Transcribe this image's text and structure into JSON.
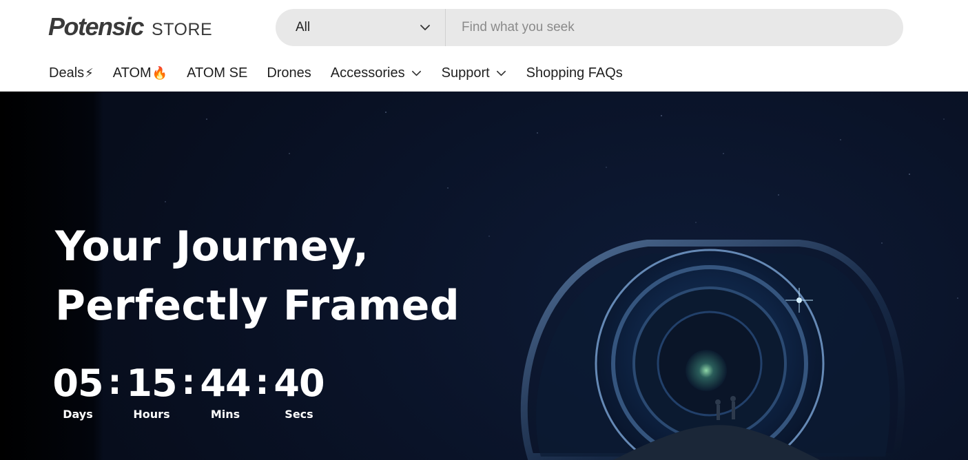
{
  "brand": {
    "name": "Potensic",
    "suffix": "STORE"
  },
  "search": {
    "category": "All",
    "placeholder": "Find what you seek"
  },
  "nav": [
    {
      "label": "Deals",
      "emoji": "⚡",
      "dropdown": false
    },
    {
      "label": "ATOM",
      "emoji": "🔥",
      "dropdown": false
    },
    {
      "label": "ATOM SE",
      "emoji": "",
      "dropdown": false
    },
    {
      "label": "Drones",
      "emoji": "",
      "dropdown": false
    },
    {
      "label": "Accessories",
      "emoji": "",
      "dropdown": true
    },
    {
      "label": "Support",
      "emoji": "",
      "dropdown": true
    },
    {
      "label": "Shopping FAQs",
      "emoji": "",
      "dropdown": false
    }
  ],
  "hero": {
    "headline_line1": "Your Journey,",
    "headline_line2": "Perfectly Framed",
    "countdown": {
      "days": "05",
      "hours": "15",
      "mins": "44",
      "secs": "40",
      "days_label": "Days",
      "hours_label": "Hours",
      "mins_label": "Mins",
      "secs_label": "Secs",
      "separator": ":"
    }
  },
  "icons": {
    "dropdown": "chevron-down-icon",
    "deals": "lightning-emoji",
    "atom": "fire-emoji"
  },
  "colors": {
    "hero_bg": "#0a1328",
    "search_bg": "#e8e8e8",
    "text_dark": "#1f1f1f",
    "text_light": "#ffffff"
  }
}
